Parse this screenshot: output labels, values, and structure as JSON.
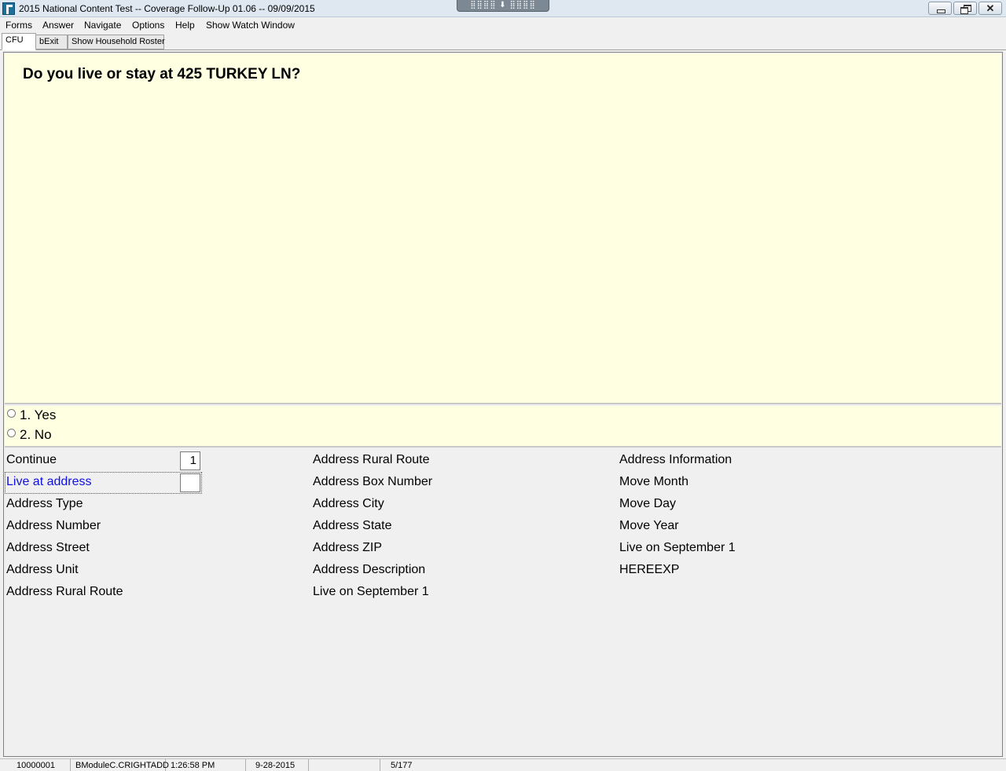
{
  "window": {
    "title": "2015 National Content Test -- Coverage Follow-Up 01.06 -- 09/09/2015",
    "remote_bar_label": "⣿⣿⣿⣿  ⬇  ⣿⣿⣿⣿",
    "close_glyph": "✕"
  },
  "menu": {
    "items": [
      "Forms",
      "Answer",
      "Navigate",
      "Options",
      "Help",
      "Show Watch Window"
    ]
  },
  "tabs": [
    {
      "label": "CFU",
      "active": true
    },
    {
      "label": "bExit",
      "active": false
    },
    {
      "label": "Show Household Roster",
      "active": false
    }
  ],
  "question": {
    "text": "Do you live or stay at 425 TURKEY LN?"
  },
  "answers": [
    {
      "label": "1. Yes",
      "selected": false
    },
    {
      "label": "2. No",
      "selected": false
    }
  ],
  "fields": {
    "column1": [
      {
        "label": "Continue",
        "value": "1",
        "active": false
      },
      {
        "label": "Live at address",
        "value": "",
        "active": true
      },
      {
        "label": "Address Type"
      },
      {
        "label": "Address Number"
      },
      {
        "label": "Address Street"
      },
      {
        "label": "Address Unit"
      },
      {
        "label": "Address Rural Route"
      }
    ],
    "column2": [
      {
        "label": "Address Rural Route"
      },
      {
        "label": "Address Box Number"
      },
      {
        "label": "Address City"
      },
      {
        "label": "Address State"
      },
      {
        "label": "Address ZIP"
      },
      {
        "label": "Address Description"
      },
      {
        "label": "Live on September 1"
      }
    ],
    "column3": [
      {
        "label": "Address Information"
      },
      {
        "label": "Move Month"
      },
      {
        "label": "Move Day"
      },
      {
        "label": "Move Year"
      },
      {
        "label": "Live on September 1"
      },
      {
        "label": "HEREEXP"
      }
    ]
  },
  "status": {
    "case_id": "10000001",
    "field_path": "BModuleC.CRIGHTADD",
    "time": "1:26:58 PM",
    "date": "9-28-2015",
    "empty": "",
    "page": "5/177"
  },
  "colors": {
    "question_bg": "#ffffe1",
    "active_field": "#1010e0",
    "chrome_bg": "#f0f0f0"
  }
}
